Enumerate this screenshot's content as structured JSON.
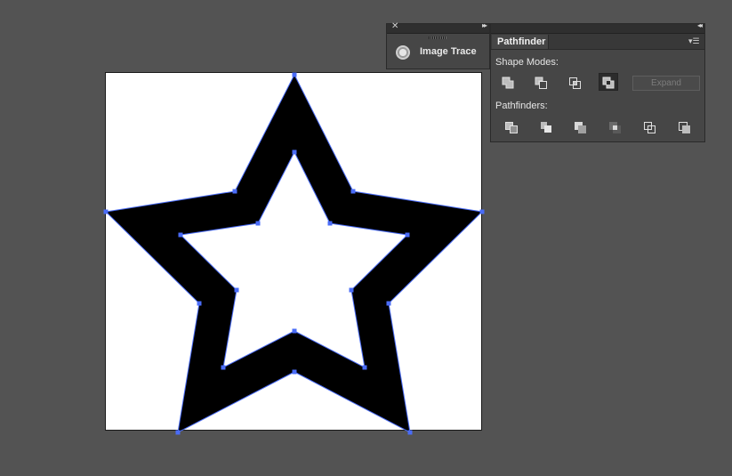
{
  "canvas": {
    "background": "#535353",
    "artboard_color": "#ffffff"
  },
  "artwork": {
    "shape": "star-with-hole",
    "fill": "#000000",
    "selection_color": "#4a6cf7"
  },
  "trace_panel": {
    "title": "Image Trace",
    "icon": "image-trace-icon"
  },
  "pathfinder_panel": {
    "tab_label": "Pathfinder",
    "shape_modes_label": "Shape Modes:",
    "pathfinders_label": "Pathfinders:",
    "expand_label": "Expand",
    "shape_modes": [
      "unite-icon",
      "minus-front-icon",
      "intersect-icon",
      "exclude-icon"
    ],
    "pathfinders": [
      "divide-icon",
      "trim-icon",
      "merge-icon",
      "crop-icon",
      "outline-icon",
      "minus-back-icon"
    ]
  }
}
